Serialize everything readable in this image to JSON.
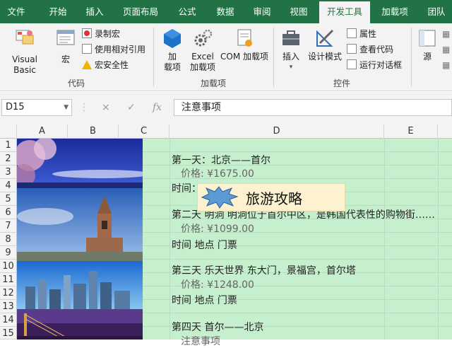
{
  "ribbon_tabs": [
    "文件",
    "开始",
    "插入",
    "页面布局",
    "公式",
    "数据",
    "审阅",
    "视图",
    "开发工具",
    "加载项",
    "团队"
  ],
  "active_tab": "开发工具",
  "groups": {
    "code": {
      "label": "代码",
      "visual_basic": "Visual Basic",
      "macros": "宏",
      "record_macro": "录制宏",
      "use_relative": "使用相对引用",
      "macro_security": "宏安全性"
    },
    "addins": {
      "label": "加载项",
      "addins_line1": "加",
      "addins_line2": "载项",
      "excel_addins_line1": "Excel",
      "excel_addins_line2": "加载项",
      "com_addins": "COM 加载项"
    },
    "controls": {
      "label": "控件",
      "insert": "插入",
      "design_mode": "设计模式",
      "properties": "属性",
      "view_code": "查看代码",
      "run_dialog": "运行对话框"
    },
    "xml": {
      "source": "源"
    }
  },
  "formula_bar": {
    "name_box": "D15",
    "formula": "注意事项",
    "cancel_icon": "×",
    "enter_icon": "✓",
    "fx": "fx"
  },
  "columns": [
    "A",
    "B",
    "C",
    "D",
    "E"
  ],
  "rows": [
    "1",
    "2",
    "3",
    "4",
    "5",
    "6",
    "7",
    "8",
    "9",
    "10",
    "11",
    "12",
    "13",
    "14",
    "15"
  ],
  "cells": {
    "r2": "第一天：北京——首尔",
    "r3": "价格: ¥1675.00",
    "r4": "时间：",
    "r6": "第二天 明洞  明洞位于首尔中区，是韩国代表性的购物街……",
    "r7": "价格: ¥1099.00",
    "r8": "时间 地点 门票",
    "r10": "第三天 乐天世界 东大门，景福宫，首尔塔",
    "r11": "价格: ¥1248.00",
    "r12": "时间 地点 门票",
    "r14": "第四天 首尔——北京",
    "r15": "注意事项"
  },
  "title_shape": "旅游攻略",
  "colors": {
    "ribbon": "#217346",
    "cell_fill": "#c6efce",
    "title_fill": "#fdf2d0"
  }
}
